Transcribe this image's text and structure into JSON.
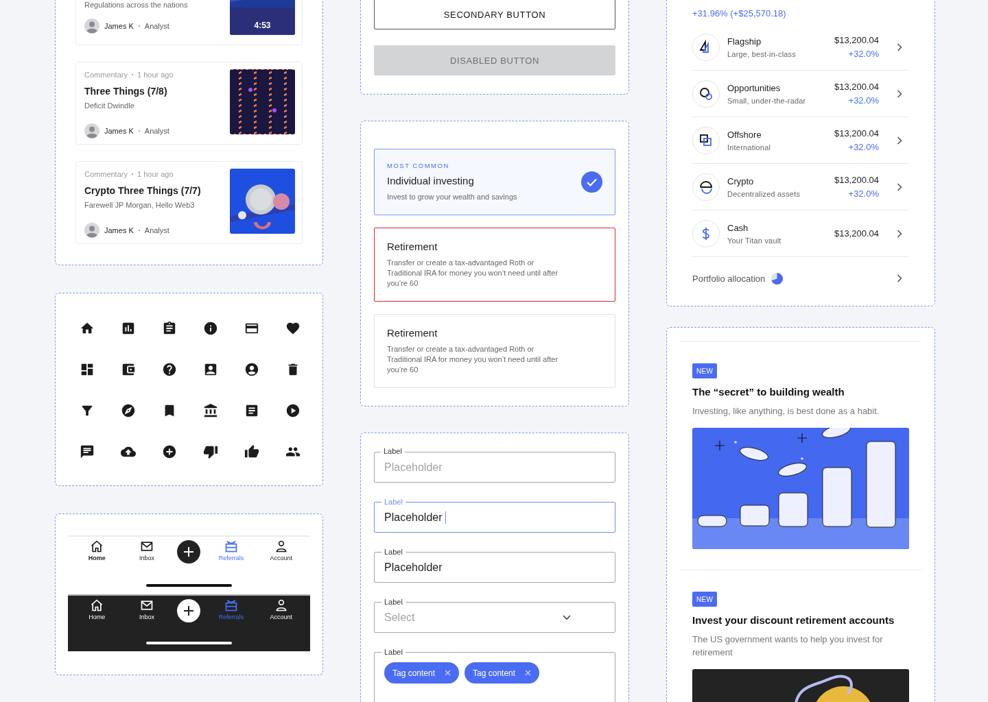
{
  "article_feed": {
    "cards": [
      {
        "kind": "video",
        "subtitle": "Regulations across the nations",
        "author": "James K",
        "role": "Analyst",
        "duration": "4:53"
      },
      {
        "kind": "article",
        "category": "Commentary",
        "time": "1 hour ago",
        "title": "Three Things (7/8)",
        "subtitle": "Deficit Dwindle",
        "author": "James K",
        "role": "Analyst"
      },
      {
        "kind": "article",
        "category": "Commentary",
        "time": "1 hour ago",
        "title": "Crypto Three Things (7/7)",
        "subtitle": "Farewell JP Morgan, Hello Web3",
        "author": "James K",
        "role": "Analyst"
      }
    ]
  },
  "bottom_navs": [
    {
      "kind": "light",
      "items": [
        {
          "kind": "tab",
          "label": "Home",
          "selected": false
        },
        {
          "kind": "tab",
          "label": "Inbox",
          "selected": false
        },
        {
          "kind": "add",
          "selected": false
        },
        {
          "kind": "tab",
          "label": "Referrals",
          "selected": true
        },
        {
          "kind": "tab",
          "label": "Account",
          "selected": false
        }
      ]
    },
    {
      "kind": "dark",
      "items": [
        {
          "kind": "tab",
          "label": "Home",
          "selected": false
        },
        {
          "kind": "tab",
          "label": "Inbox",
          "selected": false
        },
        {
          "kind": "add",
          "selected": false
        },
        {
          "kind": "tab",
          "label": "Referrals",
          "selected": true
        },
        {
          "kind": "tab",
          "label": "Account",
          "selected": false
        }
      ]
    }
  ],
  "buttons": [
    {
      "kind": "secondary",
      "label": "SECONDARY BUTTON",
      "disabled": false
    },
    {
      "kind": "primary",
      "label": "DISABLED BUTTON",
      "disabled": true
    }
  ],
  "account_options": [
    {
      "eyebrow": "MOST COMMON",
      "title": "Individual investing",
      "description": "Invest to grow your wealth and savings",
      "selected": true,
      "error": false
    },
    {
      "title": "Retirement",
      "description": "Transfer or create a tax-advantaged Roth or Traditional IRA for money you won’t need until after you’re 60",
      "selected": false,
      "error": true
    },
    {
      "title": "Retirement",
      "description": "Transfer or create a tax-advantaged Roth or Traditional IRA for money you won’t need until after you’re 60",
      "selected": false,
      "error": false
    }
  ],
  "form_fields": [
    {
      "kind": "text",
      "label": "Label",
      "placeholder": "Placeholder",
      "focused": false
    },
    {
      "kind": "text",
      "label": "Label",
      "value": "Placeholder",
      "focused": true
    },
    {
      "kind": "text",
      "label": "Label",
      "value": "Placeholder",
      "focused": false
    },
    {
      "kind": "select",
      "label": "Label",
      "placeholder": "Select",
      "focused": false
    },
    {
      "kind": "tags",
      "label": "Label",
      "tags": [
        "Tag content",
        "Tag content"
      ],
      "focused": false
    }
  ],
  "portfolio": {
    "change": "+31.96% (+$25,570.18)",
    "holdings": [
      {
        "name": "Flagship",
        "description": "Large, best-in-class",
        "value": "$13,200.04",
        "return": "+32.0%"
      },
      {
        "name": "Opportunities",
        "description": "Small, under-the-radar",
        "value": "$13,200.04",
        "return": "+32.0%"
      },
      {
        "name": "Offshore",
        "description": "International",
        "value": "$13,200.04",
        "return": "+32.0%"
      },
      {
        "name": "Crypto",
        "description": "Decentralized assets",
        "value": "$13,200.04",
        "return": "+32.0%"
      },
      {
        "name": "Cash",
        "description": "Your Titan vault",
        "value": "$13,200.04"
      }
    ],
    "allocation_label": "Portfolio allocation"
  },
  "articles": [
    {
      "badge": "NEW",
      "title": "The “secret” to building wealth",
      "description": "Investing, like anything, is best done as a habit.",
      "kind": "coins"
    },
    {
      "badge": "NEW",
      "title": "Invest your discount retirement accounts",
      "description": "The US government wants to help you invest for retirement",
      "kind": "dark"
    }
  ]
}
